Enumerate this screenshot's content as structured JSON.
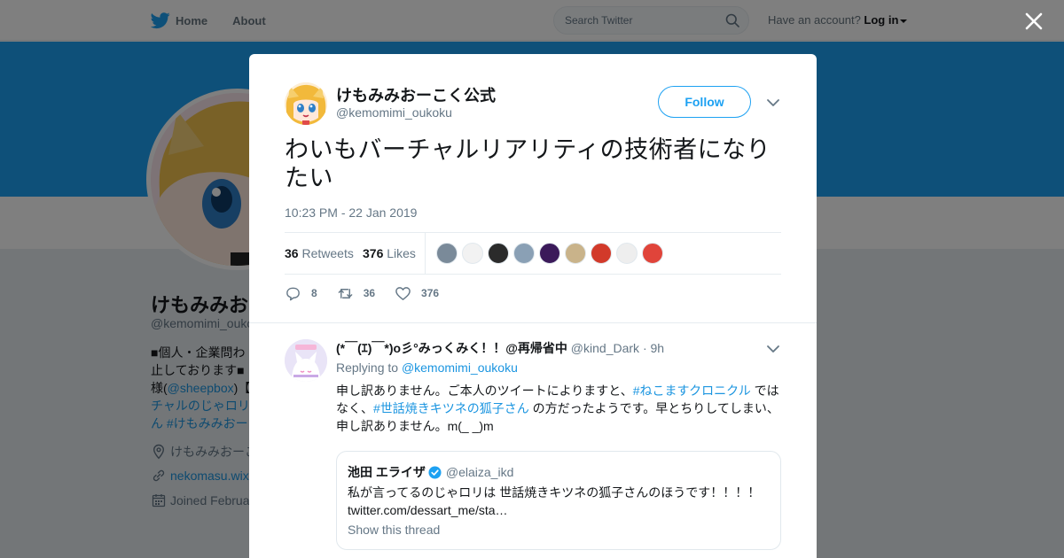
{
  "nav": {
    "home_label": "Home",
    "about_label": "About",
    "search_placeholder": "Search Twitter",
    "account_prompt": "Have an account?",
    "login_label": "Log in"
  },
  "colors": {
    "twitter_blue": "#1da1f2",
    "link_blue": "#1b95e0",
    "muted_gray": "#657786",
    "banner": "#1da1f2"
  },
  "profile": {
    "name": "けもみみおーこく公式",
    "name_visible": "けもみみお",
    "handle": "@kemomimi_oukoku",
    "handle_visible": "@kemomimi_oukoku",
    "bio_line1": "■個人・企業問わ",
    "bio_line2": "止しております■",
    "bio_line3_pre": "様(",
    "bio_line3_mention": "@sheepbox",
    "bio_line3_post": ")【",
    "bio_line4": "チャルのじゃロリ",
    "bio_line5_pre": "ん ",
    "bio_line5_tag": "#けもみみおー",
    "location": "けもみみおーこ",
    "website": "nekomasu.wix",
    "joined": "Joined Februa",
    "icons": [
      "location-pin-icon",
      "link-icon",
      "calendar-icon"
    ]
  },
  "tweet": {
    "author_name": "けもみみおーこく公式",
    "author_handle": "@kemomimi_oukoku",
    "follow_label": "Follow",
    "text": "わいもバーチャルリアリティの技術者になりたい",
    "timestamp": "10:23 PM - 22 Jan 2019",
    "retweet_count": "36",
    "retweets_label": "Retweets",
    "like_count": "376",
    "likes_label": "Likes",
    "liker_avatars": [
      "#7a8a99",
      "#f2f2f2",
      "#2b2b2b",
      "#8aa0b5",
      "#3b1a5a",
      "#c9b38a",
      "#d23a2a",
      "#eeeeee",
      "#e0443a"
    ],
    "actions": {
      "reply_count": "8",
      "retweet_count": "36",
      "like_count": "376"
    }
  },
  "reply": {
    "name": "(*￣(ｴ)￣*)o彡°みっくみく！！@再帰省中",
    "handle": "@kind_Dark",
    "time": "· 9h",
    "replying_prefix": "Replying to",
    "replying_to": "@kemomimi_oukoku",
    "text_1": "申し訳ありません。ご本人のツイートによりますと、",
    "tag_1": "#ねこますクロニクル",
    "text_2": " ではなく、",
    "tag_2": "#世話焼きキツネの狐子さん",
    "text_3": " の方だったようです。早とちりしてしまい、申し訳ありません。m(_ _)m"
  },
  "quote": {
    "name": "池田 エライザ",
    "handle": "@elaiza_ikd",
    "text": "私が言ってるのじゃロリは 世話焼きキツネの狐子さんのほうです！！！！ twitter.com/dessart_me/sta…",
    "show_thread": "Show this thread"
  }
}
